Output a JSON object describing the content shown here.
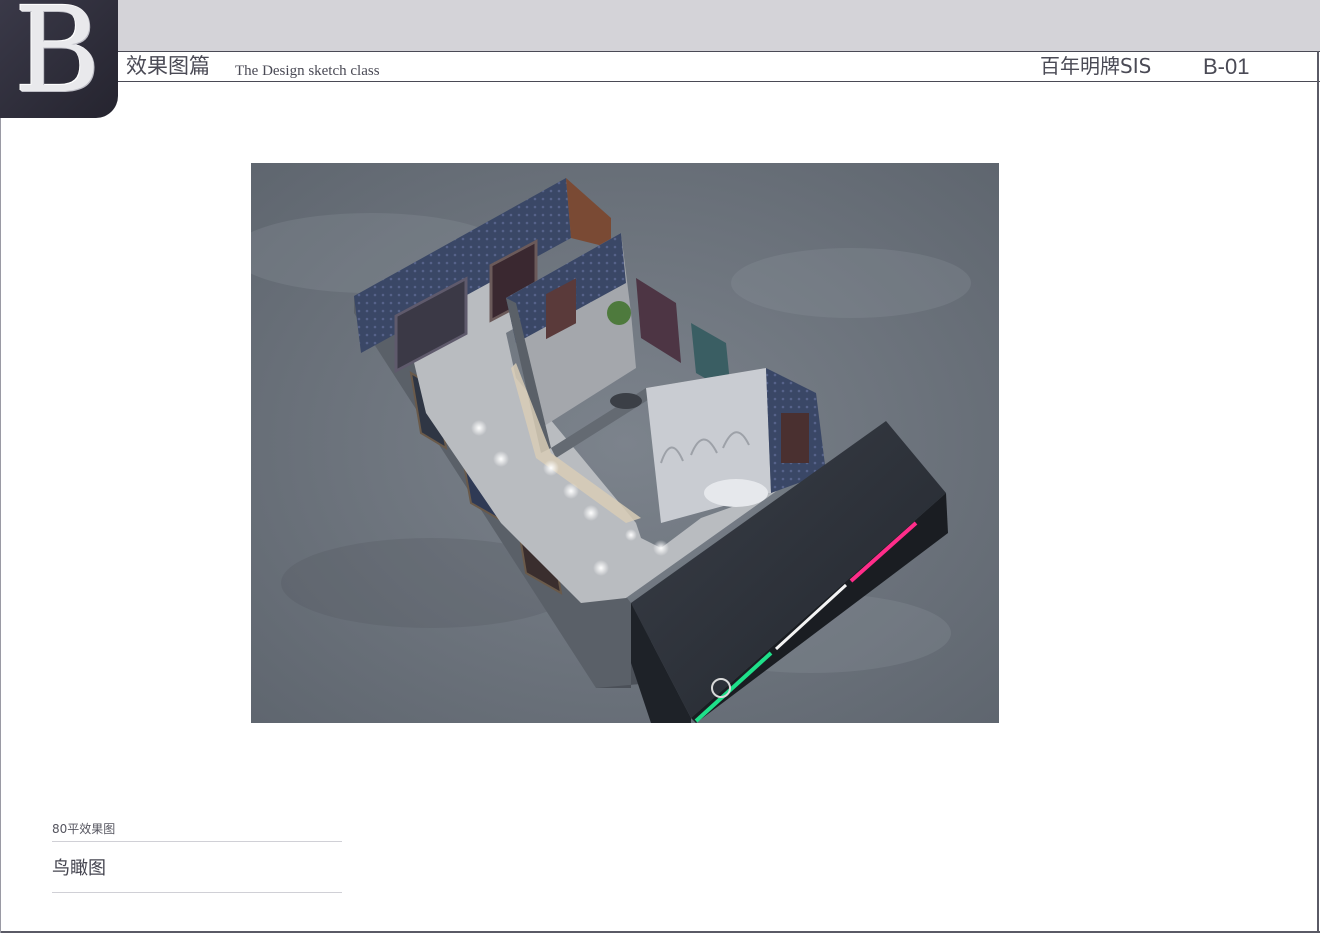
{
  "header": {
    "logo_letter": "B",
    "section_title": "效果图篇",
    "section_subtitle": "The Design sketch class",
    "brand_name": "百年明牌SIS",
    "page_code": "B-01"
  },
  "render": {
    "image_subject": "store-floor-plan-render",
    "accent_colors": {
      "neon_green": "#1fe08a",
      "neon_pink": "#ff2d8a",
      "sign_dark": "#2c3038",
      "wallpaper_blue": "#3a4766",
      "floor_gray": "#b9bcc0"
    }
  },
  "caption": {
    "subtitle": "80平效果图",
    "title": "鸟瞰图"
  }
}
